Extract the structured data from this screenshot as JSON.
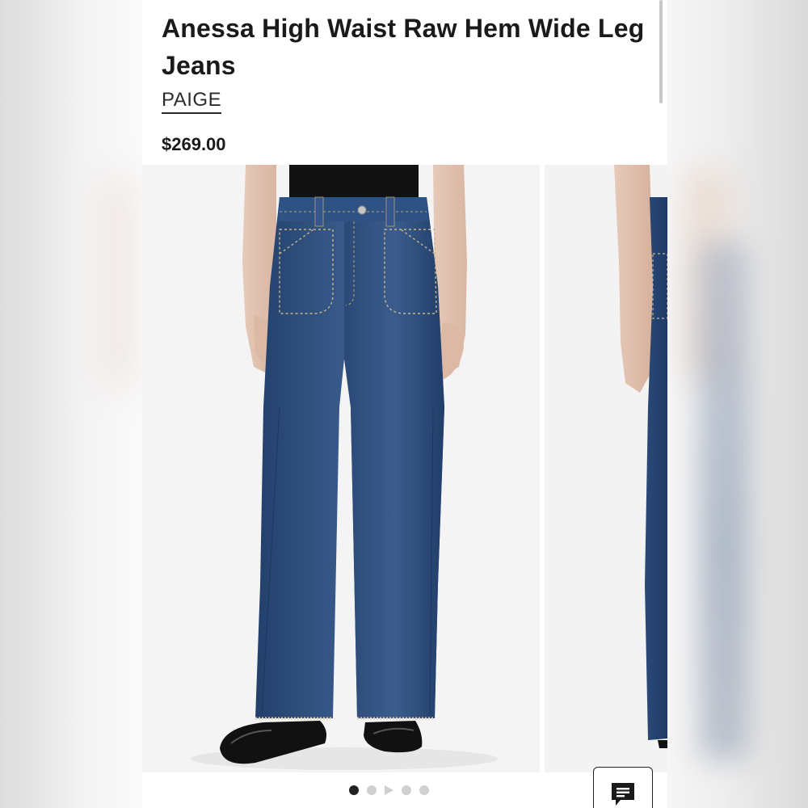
{
  "product": {
    "title": "Anessa High Waist Raw Hem Wide Leg Jeans",
    "brand": "PAIGE",
    "price": "$269.00"
  },
  "gallery": {
    "total_slides": 5,
    "active_index": 0,
    "indicators": [
      "dot",
      "dot",
      "play",
      "dot",
      "dot"
    ]
  },
  "icons": {
    "chat": "chat-bubble-icon",
    "play": "play-icon"
  },
  "colors": {
    "text": "#1a1a1a",
    "denim": "#2d4a78",
    "active_dot": "#222222",
    "inactive_dot": "#d0d0d0"
  }
}
